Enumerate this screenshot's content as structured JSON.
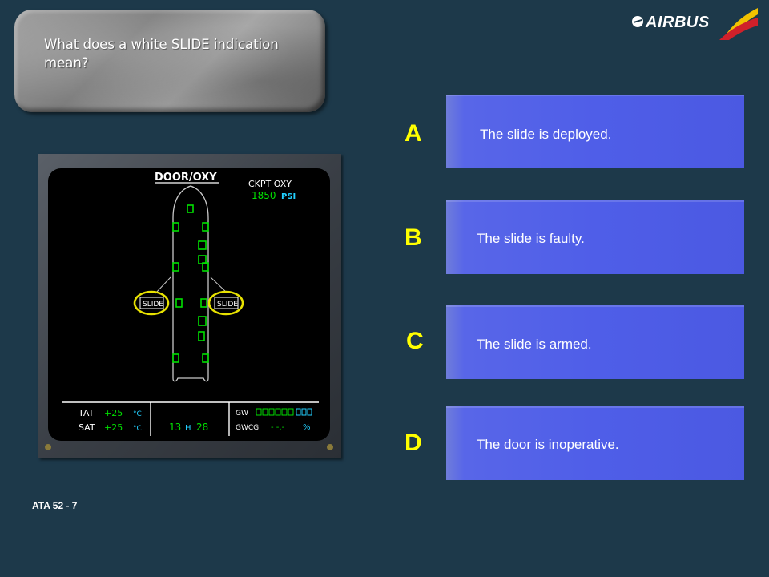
{
  "question": {
    "text": "What does a white SLIDE indication mean?"
  },
  "logo": {
    "brand": "AIRBUS"
  },
  "answers": [
    {
      "letter": "A",
      "text": "The slide is deployed."
    },
    {
      "letter": "B",
      "text": "The slide is faulty."
    },
    {
      "letter": "C",
      "text": "The slide is armed."
    },
    {
      "letter": "D",
      "text": "The door is inoperative."
    }
  ],
  "footer": {
    "code": "ATA 52 - 7"
  },
  "ecam": {
    "page_title": "DOOR/OXY",
    "ckpt_oxy_label": "CKPT OXY",
    "ckpt_oxy_value": "1850",
    "ckpt_oxy_unit": "PSI",
    "slide_left": "SLIDE",
    "slide_right": "SLIDE",
    "tat_label": "TAT",
    "tat_value": "+25",
    "sat_label": "SAT",
    "sat_value": "+25",
    "temp_unit": "°C",
    "time_hours": "13",
    "time_h": "H",
    "time_minutes": "28",
    "gw_label": "GW",
    "gwcg_label": "GWCG",
    "gwcg_value": "- -.-",
    "gwcg_unit": "%"
  },
  "colors": {
    "background": "#1d394a",
    "answer_box": "#4f5ee8",
    "answer_letter": "#ffff00",
    "ecam_green": "#00e000",
    "ecam_cyan": "#22d0ff",
    "slide_highlight": "#e8e200"
  }
}
